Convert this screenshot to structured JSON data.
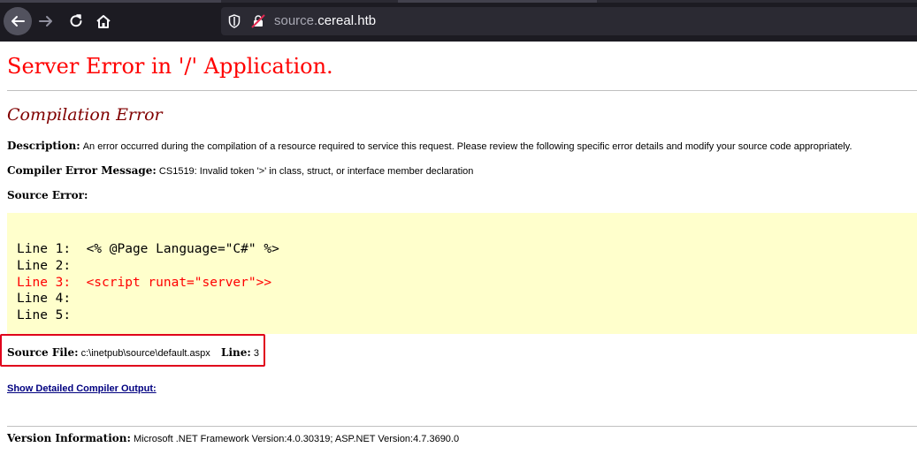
{
  "browser": {
    "url_host": "source.",
    "url_domain": "cereal.htb"
  },
  "page": {
    "title": "Server Error in '/' Application.",
    "subtitle": "Compilation Error",
    "description_label": "Description:",
    "description_text": "An error occurred during the compilation of a resource required to service this request. Please review the following specific error details and modify your source code appropriately.",
    "compiler_msg_label": "Compiler Error Message:",
    "compiler_msg_text": "CS1519: Invalid token '>' in class, struct, or interface member declaration",
    "source_error_label": "Source Error:",
    "code_lines": [
      "Line 1:  <% @Page Language=\"C#\" %>",
      "Line 2:",
      "Line 3:  <script runat=\"server\">>",
      "Line 4:",
      "Line 5:"
    ],
    "source_file_label": "Source File:",
    "source_file_value": "c:\\inetpub\\source\\default.aspx",
    "line_label": "Line:",
    "line_value": "3",
    "detail_link": "Show Detailed Compiler Output:",
    "version_label": "Version Information:",
    "version_text": "Microsoft .NET Framework Version:4.0.30319; ASP.NET Version:4.7.3690.0"
  },
  "colors": {
    "title": "#ff0000",
    "subtitle": "#800000",
    "code_bg": "#ffffcc",
    "highlight_box": "#e0001b",
    "link": "#000080"
  }
}
